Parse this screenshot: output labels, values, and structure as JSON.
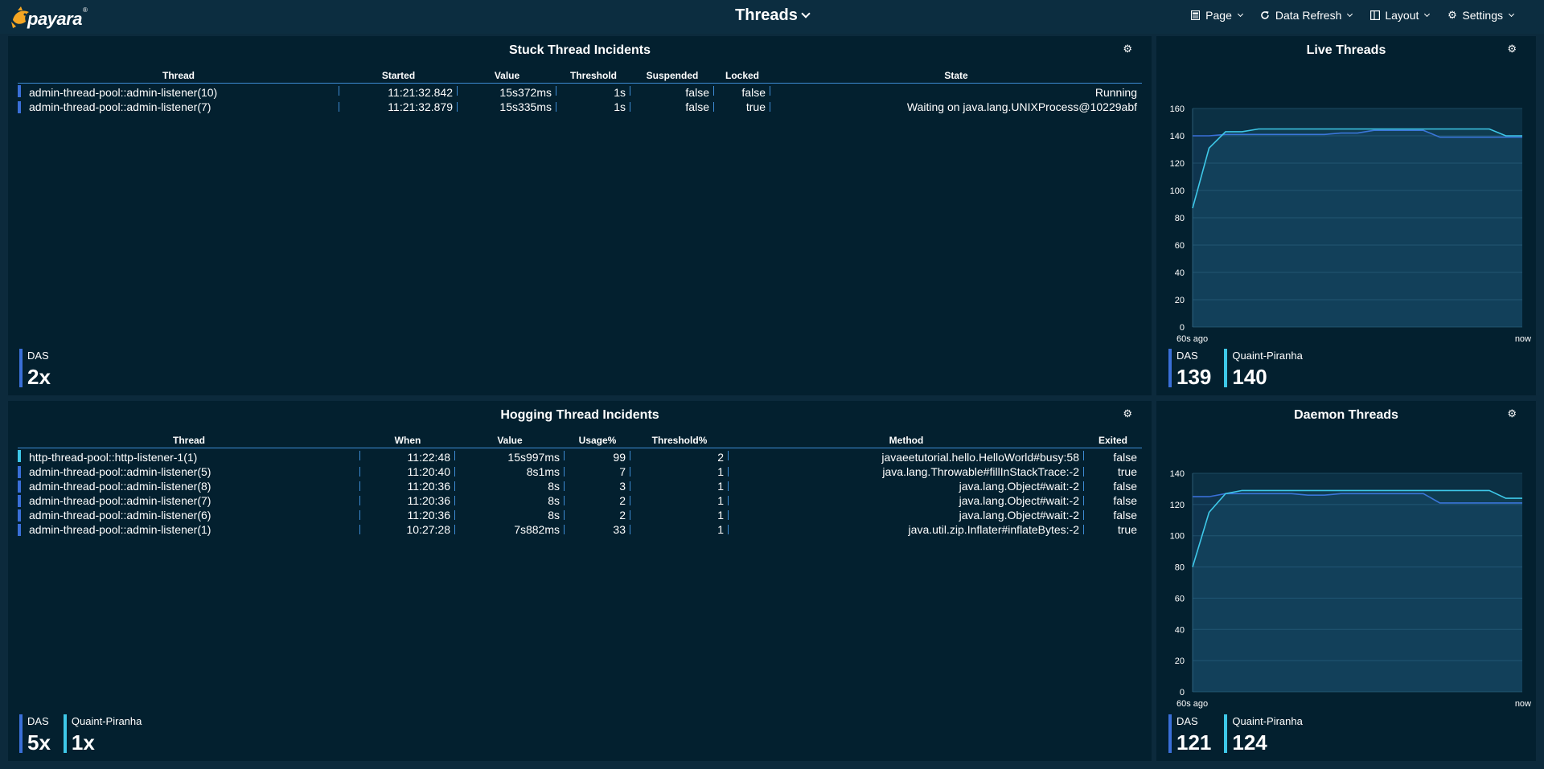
{
  "header": {
    "logo_text": "payara",
    "logo_mark": "®",
    "title": "Threads",
    "menu": [
      {
        "icon": "page-icon",
        "label": "Page"
      },
      {
        "icon": "refresh-icon",
        "label": "Data Refresh"
      },
      {
        "icon": "layout-icon",
        "label": "Layout"
      },
      {
        "icon": "gear-icon",
        "label": "Settings"
      }
    ]
  },
  "colors": {
    "background": "#0c2a3c",
    "panel": "#03202f",
    "das": "#3a6fd8",
    "quaint": "#3ec8e8",
    "accent_line": "#3d8bd4"
  },
  "stuck": {
    "title": "Stuck Thread Incidents",
    "columns": [
      "Thread",
      "Started",
      "Value",
      "Threshold",
      "Suspended",
      "Locked",
      "State"
    ],
    "rows": [
      {
        "series": "das",
        "cells": [
          "admin-thread-pool::admin-listener(10)",
          "11:21:32.842",
          "15s372ms",
          "1s",
          "false",
          "false",
          "Running"
        ]
      },
      {
        "series": "das",
        "cells": [
          "admin-thread-pool::admin-listener(7)",
          "11:21:32.879",
          "15s335ms",
          "1s",
          "false",
          "true",
          "Waiting on java.lang.UNIXProcess@10229abf"
        ]
      }
    ],
    "legend": [
      {
        "series": "das",
        "name": "DAS",
        "value": "2x"
      }
    ]
  },
  "hogging": {
    "title": "Hogging Thread Incidents",
    "columns": [
      "Thread",
      "When",
      "Value",
      "Usage%",
      "Threshold%",
      "Method",
      "Exited"
    ],
    "rows": [
      {
        "series": "quaint",
        "cells": [
          "http-thread-pool::http-listener-1(1)",
          "11:22:48",
          "15s997ms",
          "99",
          "2",
          "javaeetutorial.hello.HelloWorld#busy:58",
          "false"
        ]
      },
      {
        "series": "das",
        "cells": [
          "admin-thread-pool::admin-listener(5)",
          "11:20:40",
          "8s1ms",
          "7",
          "1",
          "java.lang.Throwable#fillInStackTrace:-2",
          "true"
        ]
      },
      {
        "series": "das",
        "cells": [
          "admin-thread-pool::admin-listener(8)",
          "11:20:36",
          "8s",
          "3",
          "1",
          "java.lang.Object#wait:-2",
          "false"
        ]
      },
      {
        "series": "das",
        "cells": [
          "admin-thread-pool::admin-listener(7)",
          "11:20:36",
          "8s",
          "2",
          "1",
          "java.lang.Object#wait:-2",
          "false"
        ]
      },
      {
        "series": "das",
        "cells": [
          "admin-thread-pool::admin-listener(6)",
          "11:20:36",
          "8s",
          "2",
          "1",
          "java.lang.Object#wait:-2",
          "false"
        ]
      },
      {
        "series": "das",
        "cells": [
          "admin-thread-pool::admin-listener(1)",
          "10:27:28",
          "7s882ms",
          "33",
          "1",
          "java.util.zip.Inflater#inflateBytes:-2",
          "true"
        ]
      }
    ],
    "legend": [
      {
        "series": "das",
        "name": "DAS",
        "value": "5x"
      },
      {
        "series": "quaint",
        "name": "Quaint-Piranha",
        "value": "1x"
      }
    ]
  },
  "live": {
    "title": "Live Threads",
    "legend": [
      {
        "series": "das",
        "name": "DAS",
        "value": "139"
      },
      {
        "series": "quaint",
        "name": "Quaint-Piranha",
        "value": "140"
      }
    ]
  },
  "daemon": {
    "title": "Daemon Threads",
    "legend": [
      {
        "series": "das",
        "name": "DAS",
        "value": "121"
      },
      {
        "series": "quaint",
        "name": "Quaint-Piranha",
        "value": "124"
      }
    ]
  },
  "chart_data": [
    {
      "type": "area",
      "title": "Live Threads",
      "x": [
        -60,
        -57,
        -54,
        -51,
        -48,
        -45,
        -42,
        -39,
        -36,
        -33,
        -30,
        -27,
        -24,
        -21,
        -18,
        -15,
        -12,
        -9,
        -6,
        -3,
        0
      ],
      "x_tick_labels": [
        "60s ago",
        "now"
      ],
      "ylim": [
        0,
        160
      ],
      "yticks": [
        0,
        20,
        40,
        60,
        80,
        100,
        120,
        140,
        160
      ],
      "grid": true,
      "series": [
        {
          "name": "DAS",
          "color": "#3a6fd8",
          "values": [
            140,
            140,
            141,
            141,
            141,
            141,
            141,
            141,
            141,
            142,
            142,
            144,
            144,
            144,
            144,
            139,
            139,
            139,
            139,
            139,
            139
          ]
        },
        {
          "name": "Quaint-Piranha",
          "color": "#3ec8e8",
          "values": [
            87,
            131,
            143,
            143,
            145,
            145,
            145,
            145,
            145,
            145,
            145,
            145,
            145,
            145,
            145,
            145,
            145,
            145,
            145,
            140,
            140
          ]
        }
      ]
    },
    {
      "type": "area",
      "title": "Daemon Threads",
      "x": [
        -60,
        -57,
        -54,
        -51,
        -48,
        -45,
        -42,
        -39,
        -36,
        -33,
        -30,
        -27,
        -24,
        -21,
        -18,
        -15,
        -12,
        -9,
        -6,
        -3,
        0
      ],
      "x_tick_labels": [
        "60s ago",
        "now"
      ],
      "ylim": [
        0,
        140
      ],
      "yticks": [
        0,
        20,
        40,
        60,
        80,
        100,
        120,
        140
      ],
      "grid": true,
      "series": [
        {
          "name": "DAS",
          "color": "#3a6fd8",
          "values": [
            125,
            125,
            127,
            127,
            127,
            127,
            127,
            126,
            126,
            127,
            127,
            127,
            127,
            127,
            127,
            121,
            121,
            121,
            121,
            121,
            121
          ]
        },
        {
          "name": "Quaint-Piranha",
          "color": "#3ec8e8",
          "values": [
            80,
            115,
            127,
            129,
            129,
            129,
            129,
            129,
            129,
            129,
            129,
            129,
            129,
            129,
            129,
            129,
            129,
            129,
            129,
            124,
            124
          ]
        }
      ]
    }
  ]
}
